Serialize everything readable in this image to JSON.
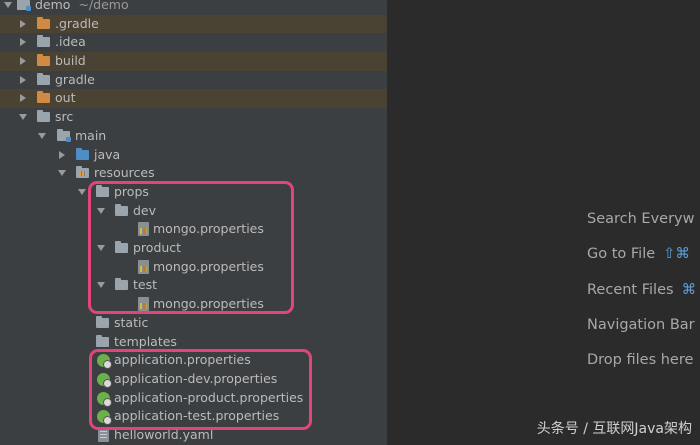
{
  "project_tree": {
    "root": {
      "name": "demo",
      "path": "~/demo"
    },
    "rows": [
      {
        "label": ".gradle"
      },
      {
        "label": ".idea"
      },
      {
        "label": "build"
      },
      {
        "label": "gradle"
      },
      {
        "label": "out"
      },
      {
        "label": "src"
      },
      {
        "label": "main"
      },
      {
        "label": "java"
      },
      {
        "label": "resources"
      },
      {
        "label": "props"
      },
      {
        "label": "dev"
      },
      {
        "label": "mongo.properties"
      },
      {
        "label": "product"
      },
      {
        "label": "mongo.properties"
      },
      {
        "label": "test"
      },
      {
        "label": "mongo.properties"
      },
      {
        "label": "static"
      },
      {
        "label": "templates"
      },
      {
        "label": "application.properties"
      },
      {
        "label": "application-dev.properties"
      },
      {
        "label": "application-product.properties"
      },
      {
        "label": "application-test.properties"
      },
      {
        "label": "helloworld.yaml"
      }
    ]
  },
  "editor_hints": [
    {
      "label": "Search Everyw"
    },
    {
      "label": "Go to File",
      "shortcut": "⇧⌘"
    },
    {
      "label": "Recent Files",
      "shortcut": "⌘"
    },
    {
      "label": "Navigation Bar"
    },
    {
      "label": "Drop files here"
    }
  ],
  "watermark": "头条号 / 互联网Java架构",
  "colors": {
    "highlight_box": "#e3457a",
    "excluded_folder": "#d08a43",
    "source_folder": "#4f8ec5",
    "shortcut": "#5e9fd8"
  }
}
